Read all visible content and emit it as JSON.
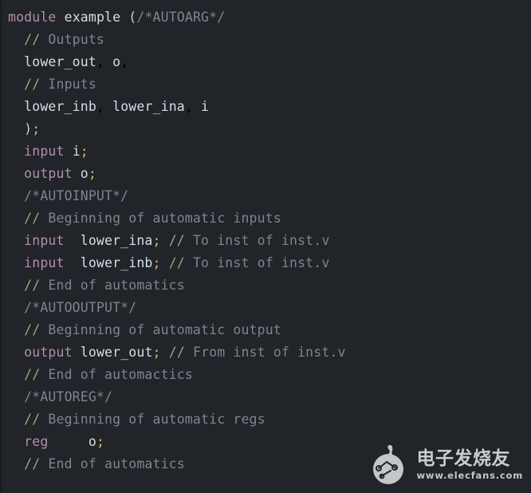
{
  "editor": {
    "background_color": "#212428",
    "language": "verilog",
    "colors": {
      "keyword": "#b48ead",
      "identifier": "#d6dde6",
      "comment": "#7d8591",
      "comment_slash": "#b0a072",
      "semicolon": "#d7b96a",
      "background": "#212428"
    }
  },
  "code": {
    "lines": [
      {
        "n": 1,
        "indent": 0,
        "tokens": [
          {
            "t": "kw",
            "v": "module"
          },
          {
            "t": "punc",
            "v": " "
          },
          {
            "t": "id",
            "v": "example"
          },
          {
            "t": "punc",
            "v": " "
          },
          {
            "t": "paren",
            "v": "("
          },
          {
            "t": "blk",
            "v": "/*AUTOARG*/"
          }
        ]
      },
      {
        "n": 2,
        "indent": 1,
        "tokens": [
          {
            "t": "cmt-sl",
            "v": "//"
          },
          {
            "t": "cmt",
            "v": " Outputs"
          }
        ]
      },
      {
        "n": 3,
        "indent": 1,
        "tokens": [
          {
            "t": "id",
            "v": "lower_out"
          },
          {
            "t": "punc",
            "v": ", "
          },
          {
            "t": "id",
            "v": "o"
          },
          {
            "t": "punc",
            "v": ","
          }
        ]
      },
      {
        "n": 4,
        "indent": 1,
        "tokens": [
          {
            "t": "cmt-sl",
            "v": "//"
          },
          {
            "t": "cmt",
            "v": " Inputs"
          }
        ]
      },
      {
        "n": 5,
        "indent": 1,
        "tokens": [
          {
            "t": "id",
            "v": "lower_inb"
          },
          {
            "t": "punc",
            "v": ", "
          },
          {
            "t": "id",
            "v": "lower_ina"
          },
          {
            "t": "punc",
            "v": ", "
          },
          {
            "t": "id",
            "v": "i"
          }
        ]
      },
      {
        "n": 6,
        "indent": 1,
        "tokens": [
          {
            "t": "paren",
            "v": ")"
          },
          {
            "t": "semi",
            "v": ";"
          }
        ]
      },
      {
        "n": 7,
        "indent": 1,
        "tokens": [
          {
            "t": "kw",
            "v": "input"
          },
          {
            "t": "punc",
            "v": " "
          },
          {
            "t": "id",
            "v": "i"
          },
          {
            "t": "semi",
            "v": ";"
          }
        ]
      },
      {
        "n": 8,
        "indent": 1,
        "tokens": [
          {
            "t": "kw",
            "v": "output"
          },
          {
            "t": "punc",
            "v": " "
          },
          {
            "t": "id",
            "v": "o"
          },
          {
            "t": "semi",
            "v": ";"
          }
        ]
      },
      {
        "n": 9,
        "indent": 1,
        "tokens": [
          {
            "t": "blk",
            "v": "/*AUTOINPUT*/"
          }
        ]
      },
      {
        "n": 10,
        "indent": 1,
        "tokens": [
          {
            "t": "cmt-sl",
            "v": "//"
          },
          {
            "t": "cmt",
            "v": " Beginning of automatic inputs"
          }
        ]
      },
      {
        "n": 11,
        "indent": 1,
        "tokens": [
          {
            "t": "kw",
            "v": "input"
          },
          {
            "t": "punc",
            "v": "  "
          },
          {
            "t": "id",
            "v": "lower_ina"
          },
          {
            "t": "semi",
            "v": ";"
          },
          {
            "t": "punc",
            "v": " "
          },
          {
            "t": "cmt-sl",
            "v": "//"
          },
          {
            "t": "cmt",
            "v": " To inst of inst.v"
          }
        ]
      },
      {
        "n": 12,
        "indent": 1,
        "tokens": [
          {
            "t": "kw",
            "v": "input"
          },
          {
            "t": "punc",
            "v": "  "
          },
          {
            "t": "id",
            "v": "lower_inb"
          },
          {
            "t": "semi",
            "v": ";"
          },
          {
            "t": "punc",
            "v": " "
          },
          {
            "t": "cmt-sl",
            "v": "//"
          },
          {
            "t": "cmt",
            "v": " To inst of inst.v"
          }
        ]
      },
      {
        "n": 13,
        "indent": 1,
        "tokens": [
          {
            "t": "cmt-sl",
            "v": "//"
          },
          {
            "t": "cmt",
            "v": " End of automatics"
          }
        ]
      },
      {
        "n": 14,
        "indent": 1,
        "tokens": [
          {
            "t": "blk",
            "v": "/*AUTOOUTPUT*/"
          }
        ]
      },
      {
        "n": 15,
        "indent": 1,
        "tokens": [
          {
            "t": "cmt-sl",
            "v": "//"
          },
          {
            "t": "cmt",
            "v": " Beginning of automatic output"
          }
        ]
      },
      {
        "n": 16,
        "indent": 1,
        "tokens": [
          {
            "t": "kw",
            "v": "output"
          },
          {
            "t": "punc",
            "v": " "
          },
          {
            "t": "id",
            "v": "lower_out"
          },
          {
            "t": "semi",
            "v": ";"
          },
          {
            "t": "punc",
            "v": " "
          },
          {
            "t": "cmt-sl",
            "v": "//"
          },
          {
            "t": "cmt",
            "v": " From inst of inst.v"
          }
        ]
      },
      {
        "n": 17,
        "indent": 1,
        "tokens": [
          {
            "t": "cmt-sl",
            "v": "//"
          },
          {
            "t": "cmt",
            "v": " End of automactics"
          }
        ]
      },
      {
        "n": 18,
        "indent": 1,
        "tokens": [
          {
            "t": "blk",
            "v": "/*AUTOREG*/"
          }
        ]
      },
      {
        "n": 19,
        "indent": 1,
        "tokens": [
          {
            "t": "cmt-sl",
            "v": "//"
          },
          {
            "t": "cmt",
            "v": " Beginning of automatic regs"
          }
        ]
      },
      {
        "n": 20,
        "indent": 1,
        "tokens": [
          {
            "t": "kw",
            "v": "reg"
          },
          {
            "t": "punc",
            "v": "     "
          },
          {
            "t": "id",
            "v": "o"
          },
          {
            "t": "semi",
            "v": ";"
          }
        ]
      },
      {
        "n": 21,
        "indent": 1,
        "tokens": [
          {
            "t": "cmt-sl",
            "v": "//"
          },
          {
            "t": "cmt",
            "v": " End of automatics"
          }
        ]
      }
    ]
  },
  "watermark": {
    "cn_text": "电子发烧友",
    "url_text": "www.elecfans.com",
    "logo_color": "#d2d4d6"
  }
}
